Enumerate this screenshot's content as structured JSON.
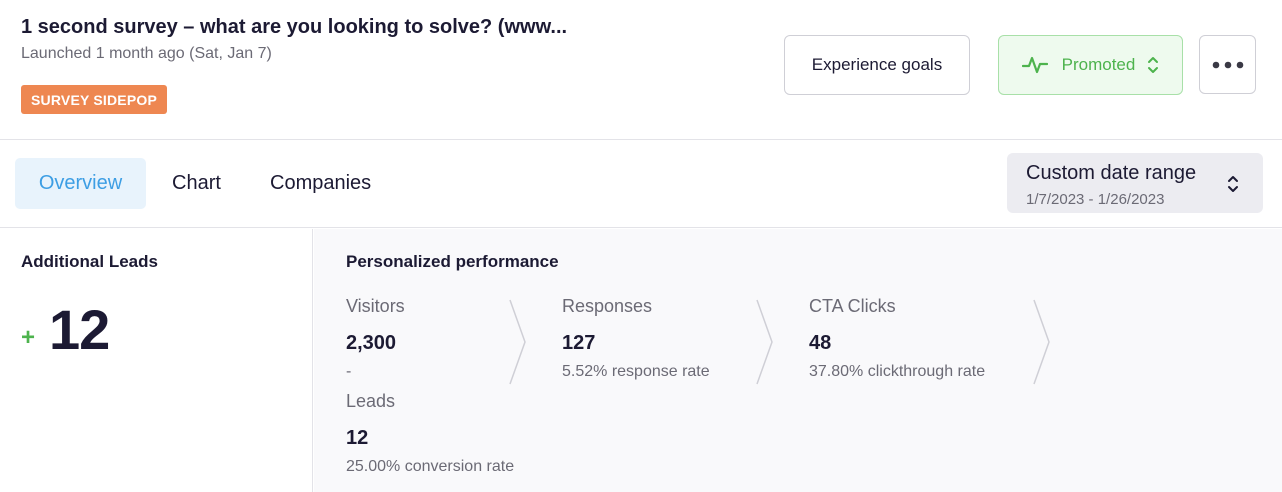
{
  "header": {
    "title": "1 second survey – what are you looking to solve? (www...",
    "subtitle": "Launched 1 month ago (Sat, Jan 7)",
    "badge": "SURVEY SIDEPOP",
    "experience_goals_label": "Experience goals",
    "promoted_label": "Promoted"
  },
  "tabs": [
    {
      "label": "Overview"
    },
    {
      "label": "Chart"
    },
    {
      "label": "Companies"
    }
  ],
  "date_range": {
    "label": "Custom date range",
    "value": "1/7/2023 - 1/26/2023"
  },
  "additional_leads": {
    "title": "Additional Leads",
    "sign": "+",
    "value": "12"
  },
  "performance": {
    "title": "Personalized performance",
    "visitors": {
      "label": "Visitors",
      "value": "2,300",
      "sub": "-"
    },
    "responses": {
      "label": "Responses",
      "value": "127",
      "sub": "5.52% response rate"
    },
    "cta_clicks": {
      "label": "CTA Clicks",
      "value": "48",
      "sub": "37.80% clickthrough rate"
    },
    "leads": {
      "label": "Leads",
      "value": "12",
      "sub": "25.00% conversion rate"
    }
  },
  "colors": {
    "badge": "#ee8751",
    "promoted": "#4db34d",
    "active_tab": "#3d9ee4",
    "text_dark": "#1c1a33"
  }
}
